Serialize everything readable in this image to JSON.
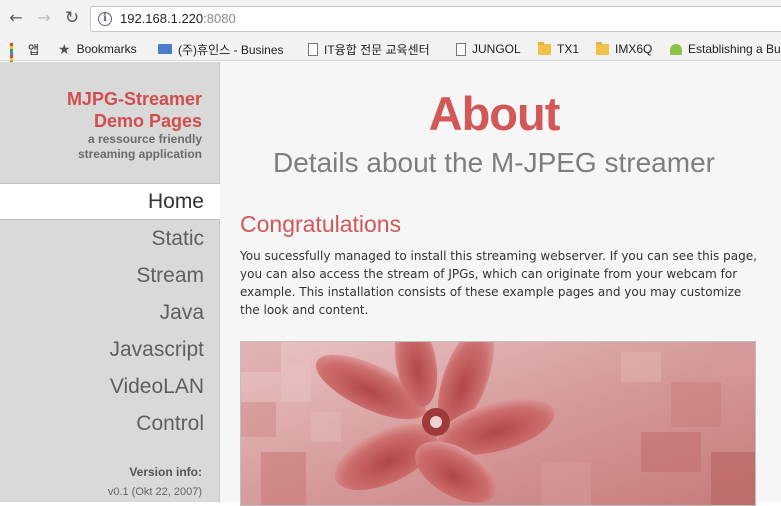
{
  "browser": {
    "url_host": "192.168.1.220",
    "url_port": ":8080",
    "icons": {
      "back": "back-arrow-icon",
      "forward": "forward-arrow-icon",
      "reload": "reload-icon",
      "info": "info-icon"
    }
  },
  "bookmarks": [
    {
      "label": "앱",
      "icon": "apps-grid-icon"
    },
    {
      "label": "Bookmarks",
      "icon": "star-icon"
    },
    {
      "label": "(주)휴인스 - Busines",
      "icon": "mail-icon"
    },
    {
      "label": "IT융합 전문 교육센터",
      "icon": "page-icon"
    },
    {
      "label": "JUNGOL",
      "icon": "page-icon"
    },
    {
      "label": "TX1",
      "icon": "folder-icon"
    },
    {
      "label": "IMX6Q",
      "icon": "folder-icon"
    },
    {
      "label": "Establishing a Bu",
      "icon": "android-icon"
    }
  ],
  "sidebar": {
    "brand_line1": "MJPG-Streamer",
    "brand_line2": "Demo Pages",
    "tagline_line1": "a ressource friendly",
    "tagline_line2": "streaming application",
    "menu": [
      {
        "label": "Home",
        "active": true
      },
      {
        "label": "Static",
        "active": false
      },
      {
        "label": "Stream",
        "active": false
      },
      {
        "label": "Java",
        "active": false
      },
      {
        "label": "Javascript",
        "active": false
      },
      {
        "label": "VideoLAN",
        "active": false
      },
      {
        "label": "Control",
        "active": false
      }
    ],
    "version_label": "Version info:",
    "version_value": "v0.1 (Okt 22, 2007)"
  },
  "main": {
    "title": "About",
    "subtitle": "Details about the M-JPEG streamer",
    "heading": "Congratulations",
    "body": "You sucessfully managed to install this streaming webserver. If you can see this page, you can also access the stream of JPGs, which can originate from your webcam for example. This installation consists of these example pages and you may customize the look and content."
  },
  "colors": {
    "accent": "#d25757",
    "sidebar_bg": "#d9d9d9",
    "page_bg": "#f6f6f6"
  }
}
